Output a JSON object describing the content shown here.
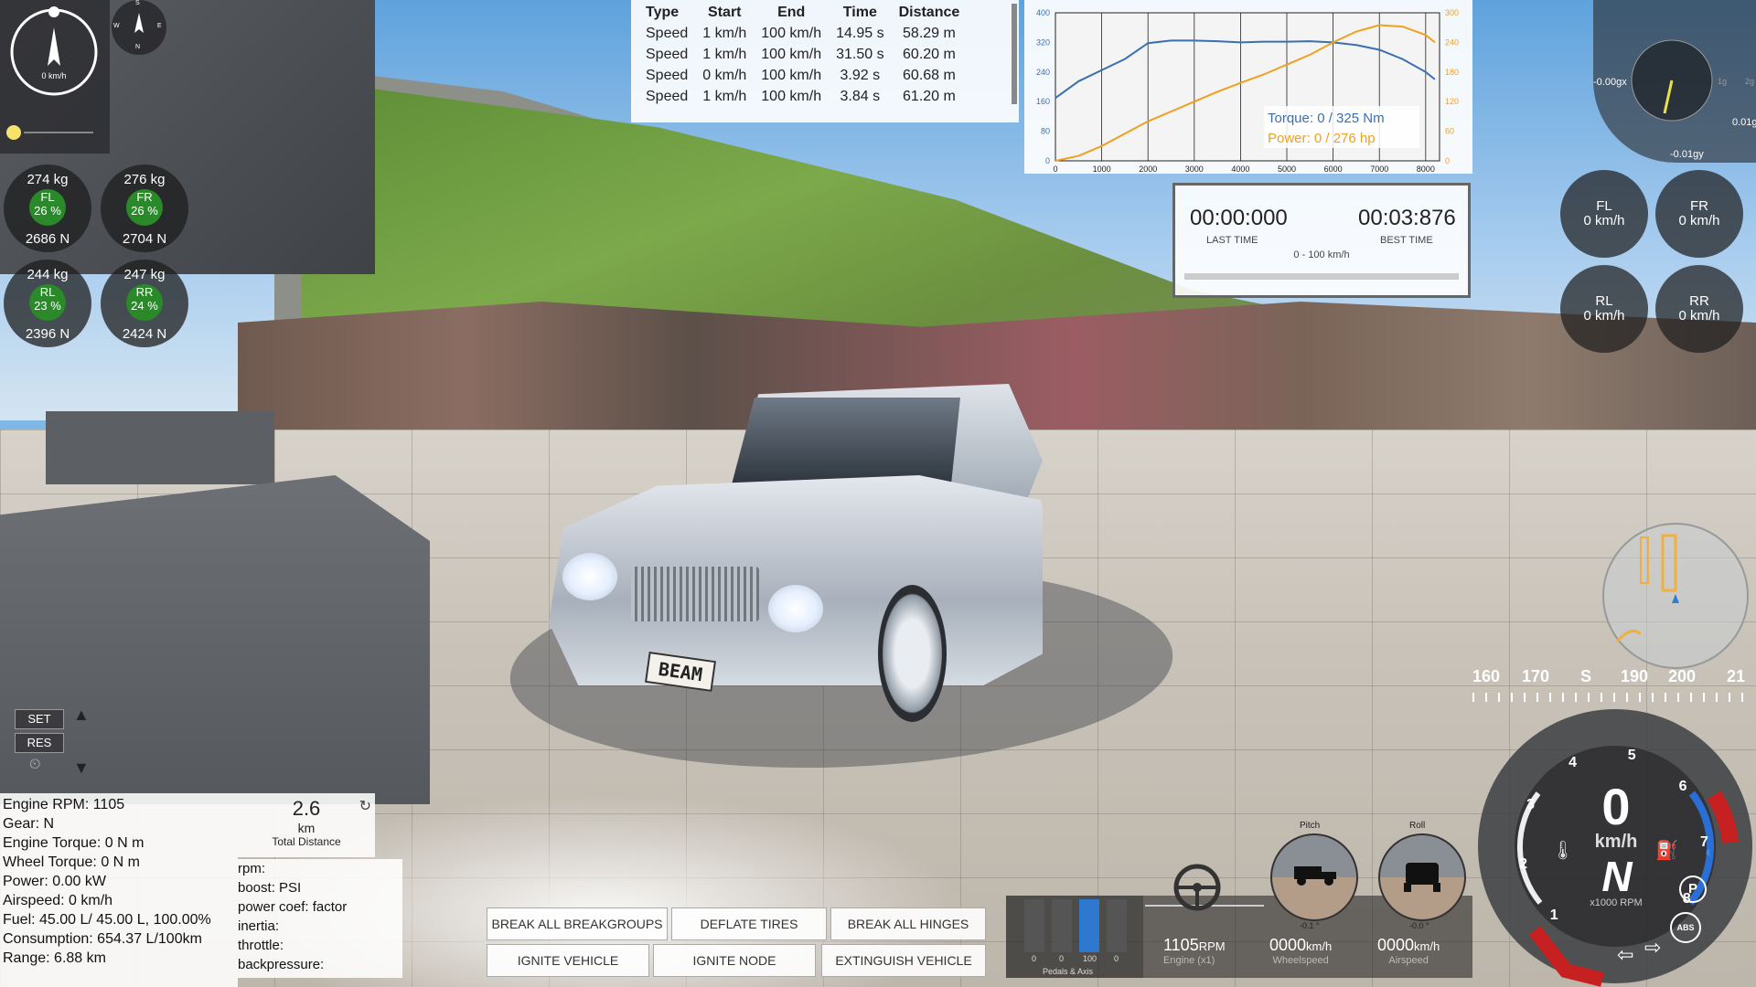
{
  "compass": {
    "speed": "0 km/h",
    "mini_letters": [
      "S",
      "W",
      "N",
      "E"
    ]
  },
  "tires": [
    {
      "id": "FL",
      "kg": "274  kg",
      "pct": "26 %",
      "n": "2686  N"
    },
    {
      "id": "FR",
      "kg": "276  kg",
      "pct": "26 %",
      "n": "2704  N"
    },
    {
      "id": "RL",
      "kg": "244  kg",
      "pct": "23 %",
      "n": "2396  N"
    },
    {
      "id": "RR",
      "kg": "247  kg",
      "pct": "24 %",
      "n": "2424  N"
    }
  ],
  "results_table": {
    "headers": [
      "Type",
      "Start",
      "End",
      "Time",
      "Distance"
    ],
    "rows": [
      [
        "Speed",
        "1 km/h",
        "100 km/h",
        "14.95 s",
        "58.29 m"
      ],
      [
        "Speed",
        "1 km/h",
        "100 km/h",
        "31.50 s",
        "60.20 m"
      ],
      [
        "Speed",
        "0 km/h",
        "100 km/h",
        "3.92 s",
        "60.68 m"
      ],
      [
        "Speed",
        "1 km/h",
        "100 km/h",
        "3.84 s",
        "61.20 m"
      ]
    ]
  },
  "chart_data": {
    "type": "line",
    "x": [
      0,
      500,
      1000,
      1500,
      2000,
      2500,
      3000,
      3500,
      4000,
      4500,
      5000,
      5500,
      6000,
      6500,
      7000,
      7500,
      8000,
      8200
    ],
    "xlim": [
      0,
      8300
    ],
    "ylim_left": [
      0,
      400
    ],
    "ylim_right": [
      0,
      300
    ],
    "x_ticks": [
      "0",
      "1000",
      "2000",
      "3000",
      "4000",
      "5000",
      "6000",
      "7000",
      "8000"
    ],
    "y_ticks_left": [
      "0",
      "80",
      "160",
      "240",
      "320",
      "400"
    ],
    "y_ticks_right": [
      "0",
      "60",
      "120",
      "180",
      "240",
      "300"
    ],
    "series": [
      {
        "name": "Torque",
        "axis": "left",
        "color": "#3a6fb0",
        "values": [
          170,
          215,
          245,
          275,
          318,
          325,
          325,
          323,
          320,
          322,
          322,
          323,
          320,
          313,
          300,
          275,
          240,
          220
        ]
      },
      {
        "name": "Power",
        "axis": "right",
        "color": "#f0a020",
        "values": [
          0,
          10,
          30,
          55,
          80,
          100,
          120,
          140,
          158,
          175,
          195,
          215,
          240,
          262,
          275,
          272,
          255,
          240
        ]
      }
    ],
    "legend": {
      "torque": "Torque: 0 / 325 Nm",
      "power": "Power: 0 / 276 hp"
    }
  },
  "timer": {
    "last_time": "00:00:000",
    "last_label": "LAST TIME",
    "best_time": "00:03:876",
    "best_label": "BEST TIME",
    "mode": "0 - 100 km/h"
  },
  "gforce": {
    "x": "-0.00gx",
    "y": "-0.01gy",
    "z": "0.01g",
    "tick_labels": [
      "1g",
      "2g"
    ]
  },
  "wheel_speeds": [
    {
      "id": "FL",
      "speed": "0  km/h"
    },
    {
      "id": "FR",
      "speed": "0  km/h"
    },
    {
      "id": "RL",
      "speed": "0  km/h"
    },
    {
      "id": "RR",
      "speed": "0  km/h"
    }
  ],
  "heading_strip": [
    "160",
    "170",
    "S",
    "190",
    "200",
    "21"
  ],
  "cruise": {
    "set": "SET",
    "res": "RES"
  },
  "info_lines": [
    "Engine RPM: 1105",
    "Gear: N",
    "Engine Torque: 0 N m",
    "Wheel Torque: 0 N m",
    "Power: 0.00 kW",
    "Airspeed: 0 km/h",
    "Fuel: 45.00 L/ 45.00 L, 100.00%",
    "Consumption: 654.37 L/100km",
    "Range: 6.88 km"
  ],
  "distance": {
    "value": "2.6",
    "unit": "km",
    "label": "Total Distance"
  },
  "rpm_info": [
    "rpm:",
    "boost: PSI",
    "power coef: factor",
    "inertia:",
    "throttle:",
    "backpressure:"
  ],
  "buttons": {
    "break_breakgroups": "BREAK ALL BREAKGROUPS",
    "deflate_tires": "DEFLATE TIRES",
    "break_hinges": "BREAK ALL HINGES",
    "ignite_vehicle": "IGNITE VEHICLE",
    "ignite_node": "IGNITE NODE",
    "extinguish": "EXTINGUISH VEHICLE"
  },
  "pedals": {
    "values": [
      "0",
      "0",
      "100",
      "0"
    ],
    "label": "Pedals & Axis",
    "fill": [
      0,
      0,
      1,
      0
    ]
  },
  "pitch_roll": {
    "pitch_label": "Pitch",
    "roll_label": "Roll",
    "pitch_value": "-0.1 °",
    "roll_value": "-0.0 °"
  },
  "bottom_readouts": {
    "rpm": "1105",
    "rpm_unit": "RPM",
    "engine_label": "Engine (x1)",
    "wheelspeed": "0000",
    "ws_unit": "km/h",
    "ws_label": "Wheelspeed",
    "airspeed": "0000",
    "as_unit": "km/h",
    "as_label": "Airspeed"
  },
  "gauge": {
    "speed": "0",
    "unit": "km/h",
    "gear": "N",
    "rpm_label": "x1000 RPM",
    "rpm_ticks": [
      "1",
      "2",
      "3",
      "4",
      "5",
      "6",
      "7",
      "8"
    ],
    "badges": [
      "P",
      "ABS"
    ]
  },
  "plate": "BEAM"
}
